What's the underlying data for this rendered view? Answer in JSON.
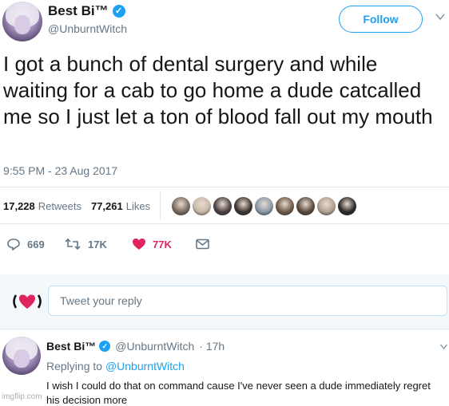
{
  "author": {
    "display_name": "Best Bi™",
    "handle": "@UnburntWitch",
    "verified": true
  },
  "follow_button_label": "Follow",
  "tweet": {
    "text": "I got a bunch of dental surgery and while waiting for a cab to go home a dude catcalled me so I just let a ton of blood fall out my mouth",
    "timestamp": "9:55 PM - 23 Aug 2017"
  },
  "stats": {
    "retweets_count": "17,228",
    "retweets_label": "Retweets",
    "likes_count": "77,261",
    "likes_label": "Likes",
    "liker_avatars": [
      "#7a6a60",
      "#c9b8a8",
      "#4a4040",
      "#3d3530",
      "#8a98a8",
      "#6e5a48",
      "#5a4a40",
      "#b0a090",
      "#2e2a2a"
    ]
  },
  "actions": {
    "reply_count": "669",
    "retweet_count": "17K",
    "like_count": "77K"
  },
  "reply_box": {
    "placeholder": "Tweet your reply"
  },
  "reply": {
    "display_name": "Best Bi™",
    "handle": "@UnburntWitch",
    "time": "· 17h",
    "replying_prefix": "Replying to",
    "replying_handle": "@UnburntWitch",
    "text": "I wish I could do that on command cause I've never seen a dude immediately regret his decision more"
  },
  "watermark": "imgflip.com",
  "colors": {
    "accent": "#1da1f2",
    "like": "#e0245e",
    "muted": "#657786"
  }
}
